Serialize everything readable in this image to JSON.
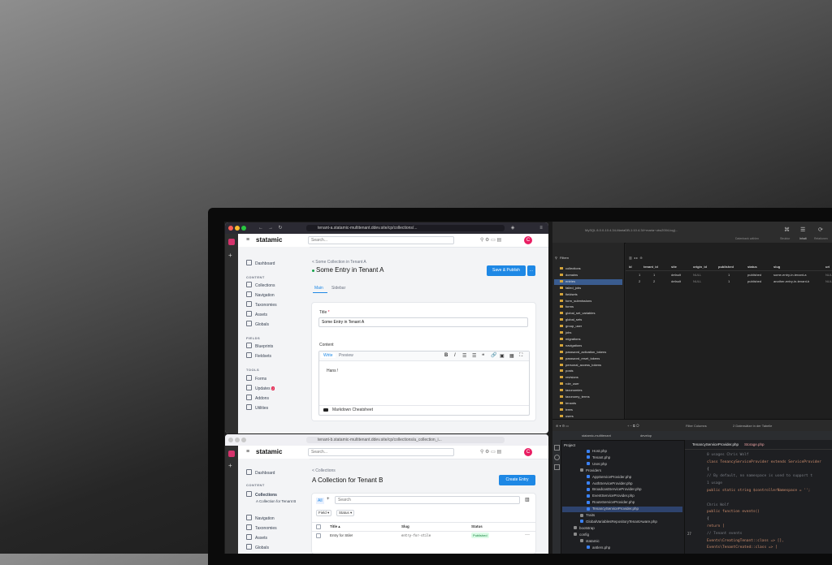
{
  "browser_a": {
    "url": "tenant-a.statamic-multitenant.ddev.site/cp/collections/...",
    "app_name": "statamic",
    "search_placeholder": "Search...",
    "avatar_letter": "C",
    "nav": {
      "dashboard": "Dashboard",
      "content_header": "CONTENT",
      "collections": "Collections",
      "navigation": "Navigation",
      "taxonomies": "Taxonomies",
      "assets": "Assets",
      "globals": "Globals",
      "fields_header": "FIELDS",
      "blueprints": "Blueprints",
      "fieldsets": "Fieldsets",
      "tools_header": "TOOLS",
      "forms": "Forms",
      "updates": "Updates",
      "updates_badge": "2",
      "addons": "Addons",
      "utilities": "Utilities"
    },
    "breadcrumb": "< Some Collection in Tenant A",
    "title": "Some Entry in Tenant A",
    "save_button": "Save & Publish",
    "more_button": "...",
    "tabs": [
      "Main",
      "Sidebar"
    ],
    "title_label": "Title",
    "title_value": "Some Entry in Tenant A",
    "content_label": "Content",
    "editor_tabs": [
      "Write",
      "Preview"
    ],
    "toolbar_icons": [
      "B",
      "I",
      "☰",
      "☰",
      "❝",
      "🔗",
      "▣",
      "▦",
      "⛶"
    ],
    "editor_body": "Hans !",
    "cheatsheet": "Markdown Cheatsheet"
  },
  "browser_b": {
    "url": "tenant-b.statamic-multitenant.ddev.site/cp/collections/a_collection_i...",
    "app_name": "statamic",
    "search_placeholder": "Search...",
    "avatar_letter": "C",
    "nav": {
      "dashboard": "Dashboard",
      "content_header": "CONTENT",
      "collections": "Collections",
      "sub_collection": "A Collection for Tenant B",
      "navigation": "Navigation",
      "taxonomies": "Taxonomies",
      "assets": "Assets",
      "globals": "Globals"
    },
    "breadcrumb": "< Collections",
    "title": "A Collection for Tenant B",
    "create_button": "Create Entry",
    "filter_all": "All",
    "search_placeholder_2": "Search",
    "field_filter": "Field",
    "status_filter": "Status",
    "columns": [
      "Title",
      "Slug",
      "Status"
    ],
    "row": {
      "title": "Entry for Stile!",
      "slug": "entry-for-stile",
      "status": "Published"
    }
  },
  "db": {
    "title": "MySQL 8.0.0-10.4.34-MariaDB-1:10.4.34+maria~ubu2004-log)...",
    "toolbar_labels": [
      "Datenbank wählen",
      "Struktur",
      "Inhalt",
      "Relationen"
    ],
    "filter_label": "Filtern",
    "tables": [
      "collections",
      "domains",
      "entries",
      "failed_jobs",
      "fieldsets",
      "form_submissions",
      "forms",
      "global_set_variables",
      "global_sets",
      "group_user",
      "jobs",
      "migrations",
      "navigations",
      "password_activation_tokens",
      "password_reset_tokens",
      "personal_access_tokens",
      "posts",
      "revisions",
      "role_user",
      "taxonomies",
      "taxonomy_terms",
      "tenants",
      "trees",
      "users"
    ],
    "columns": [
      "id",
      "tenant_id",
      "site",
      "origin_id",
      "published",
      "status",
      "slug",
      "uri"
    ],
    "rows": [
      [
        "1",
        "1",
        "default",
        "NULL",
        "1",
        "published",
        "some-entry-in-tenant-a",
        "NUL"
      ],
      [
        "2",
        "2",
        "default",
        "NULL",
        "1",
        "published",
        "another-entry-in-tenant-b",
        "NUL"
      ]
    ],
    "footer_filter": "Filter Columns",
    "footer_count": "2 Datensätze in der Tabelle"
  },
  "ide": {
    "project_label": "Project",
    "repo_tab": "statamic-multitenant",
    "branch_tab": "develop",
    "file_tabs": [
      "TenancyServiceProvider.php",
      "Storage.php"
    ],
    "tree": [
      {
        "name": "Host.php",
        "indent": 4,
        "kind": "php"
      },
      {
        "name": "Tenant.php",
        "indent": 4,
        "kind": "php"
      },
      {
        "name": "User.php",
        "indent": 4,
        "kind": "php"
      },
      {
        "name": "Providers",
        "indent": 3,
        "kind": "folder"
      },
      {
        "name": "AppServiceProvider.php",
        "indent": 4,
        "kind": "php"
      },
      {
        "name": "AuthServiceProvider.php",
        "indent": 4,
        "kind": "php"
      },
      {
        "name": "BroadcastServiceProvider.php",
        "indent": 4,
        "kind": "php"
      },
      {
        "name": "EventServiceProvider.php",
        "indent": 4,
        "kind": "php"
      },
      {
        "name": "RouteServiceProvider.php",
        "indent": 4,
        "kind": "php"
      },
      {
        "name": "TenancyServiceProvider.php",
        "indent": 4,
        "kind": "php"
      },
      {
        "name": "Traits",
        "indent": 3,
        "kind": "folder"
      },
      {
        "name": "GlobalVariablesRepositoryTenantAware.php",
        "indent": 3,
        "kind": "php"
      },
      {
        "name": "bootstrap",
        "indent": 2,
        "kind": "folder"
      },
      {
        "name": "config",
        "indent": 2,
        "kind": "folder"
      },
      {
        "name": "statamic",
        "indent": 3,
        "kind": "folder"
      },
      {
        "name": "antlers.php",
        "indent": 4,
        "kind": "php"
      }
    ],
    "line_numbers": [
      "",
      "",
      "",
      "",
      "",
      "",
      "",
      "",
      "",
      "",
      "",
      "27",
      "",
      "",
      ""
    ],
    "code_lines": [
      "0 usages  Chris Wolf",
      "class TenancyServiceProvider extends ServiceProvider",
      "{",
      "    // By default, no namespace is used to support t",
      "    1 usage",
      "    public static string $controllerNamespace = '';",
      "",
      "    Chris Wolf",
      "    public function events()",
      "    {",
      "        return [",
      "            // Tenant events",
      "            Events\\CreatingTenant::class => [],",
      "            Events\\TenantCreated::class => [",
      ""
    ]
  }
}
